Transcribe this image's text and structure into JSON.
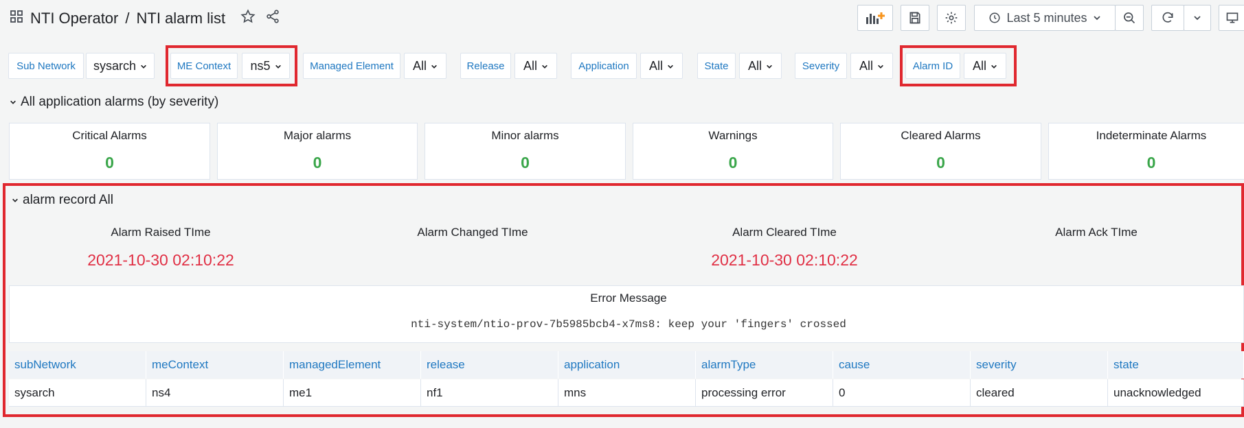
{
  "breadcrumb": {
    "folder": "NTI Operator",
    "separator": "/",
    "dashboard": "NTI alarm list"
  },
  "toolbar": {
    "time_range": "Last 5 minutes"
  },
  "variables": [
    {
      "label": "Sub Network",
      "value": "sysarch"
    },
    {
      "label": "ME Context",
      "value": "ns5"
    },
    {
      "label": "Managed Element",
      "value": "All"
    },
    {
      "label": "Release",
      "value": "All"
    },
    {
      "label": "Application",
      "value": "All"
    },
    {
      "label": "State",
      "value": "All"
    },
    {
      "label": "Severity",
      "value": "All"
    },
    {
      "label": "Alarm ID",
      "value": "All"
    }
  ],
  "section1": {
    "title": "All application alarms (by severity)"
  },
  "stats": [
    {
      "title": "Critical Alarms",
      "value": "0"
    },
    {
      "title": "Major alarms",
      "value": "0"
    },
    {
      "title": "Minor alarms",
      "value": "0"
    },
    {
      "title": "Warnings",
      "value": "0"
    },
    {
      "title": "Cleared Alarms",
      "value": "0"
    },
    {
      "title": "Indeterminate Alarms",
      "value": "0"
    }
  ],
  "section2": {
    "title": "alarm record All"
  },
  "times": [
    {
      "title": "Alarm Raised TIme",
      "value": "2021-10-30 02:10:22"
    },
    {
      "title": "Alarm Changed TIme",
      "value": ""
    },
    {
      "title": "Alarm Cleared TIme",
      "value": "2021-10-30 02:10:22"
    },
    {
      "title": "Alarm Ack TIme",
      "value": ""
    }
  ],
  "error": {
    "title": "Error Message",
    "message": "nti-system/ntio-prov-7b5985bcb4-x7ms8: keep your 'fingers' crossed"
  },
  "table": {
    "columns": [
      "subNetwork",
      "meContext",
      "managedElement",
      "release",
      "application",
      "alarmType",
      "cause",
      "severity",
      "state"
    ],
    "row": [
      "sysarch",
      "ns4",
      "me1",
      "nf1",
      "mns",
      "processing error",
      "0",
      "cleared",
      "unacknowledged"
    ]
  },
  "colors": {
    "link": "#1f78c1",
    "ok": "#3aa64a",
    "alert": "#e02f44",
    "highlight": "#e0282f"
  }
}
